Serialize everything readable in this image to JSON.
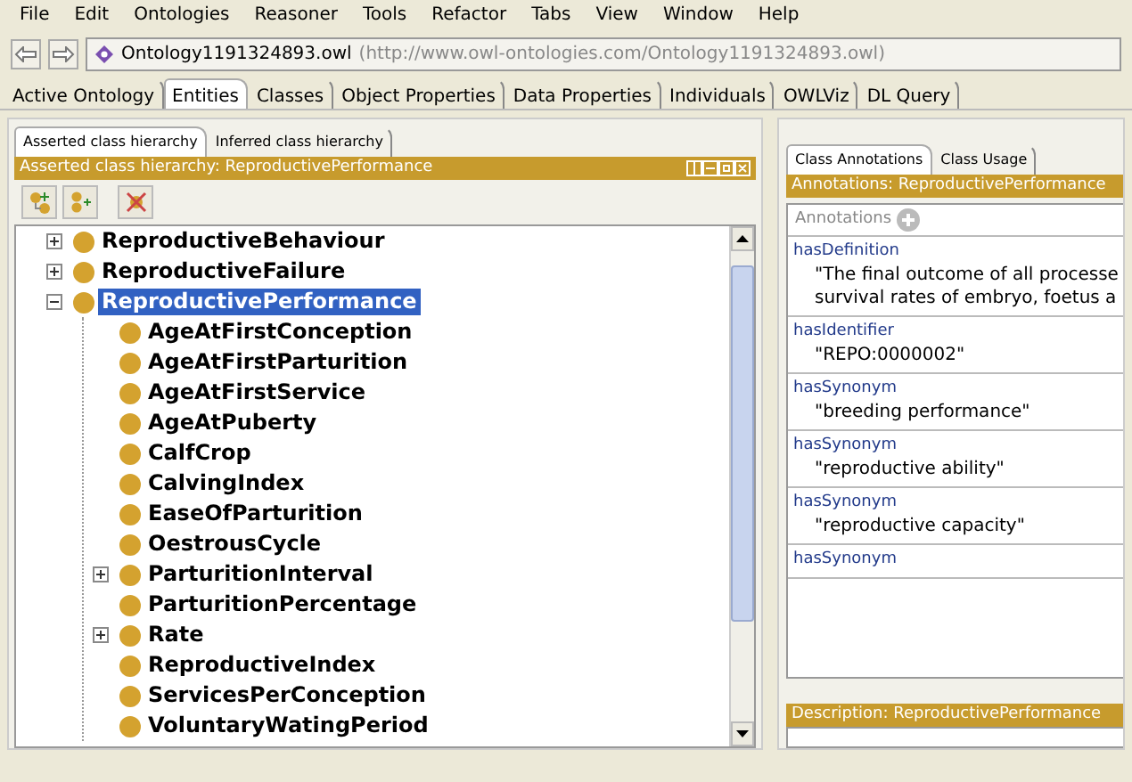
{
  "menu": [
    "File",
    "Edit",
    "Ontologies",
    "Reasoner",
    "Tools",
    "Refactor",
    "Tabs",
    "View",
    "Window",
    "Help"
  ],
  "address": {
    "name": "Ontology1191324893.owl",
    "uri": "(http://www.owl-ontologies.com/Ontology1191324893.owl)"
  },
  "tabs": [
    {
      "label": "Active Ontology",
      "selected": false
    },
    {
      "label": "Entities",
      "selected": true
    },
    {
      "label": "Classes",
      "selected": false
    },
    {
      "label": "Object Properties",
      "selected": false
    },
    {
      "label": "Data Properties",
      "selected": false
    },
    {
      "label": "Individuals",
      "selected": false
    },
    {
      "label": "OWLViz",
      "selected": false
    },
    {
      "label": "DL Query",
      "selected": false
    }
  ],
  "hierarchy": {
    "tabs": [
      {
        "label": "Asserted class hierarchy",
        "selected": true
      },
      {
        "label": "Inferred class hierarchy",
        "selected": false
      }
    ],
    "title": "Asserted class hierarchy: ReproductivePerformance",
    "tree": [
      {
        "label": "ReproductiveBehaviour",
        "expanded": false,
        "selected": false
      },
      {
        "label": "ReproductiveFailure",
        "expanded": false,
        "selected": false
      },
      {
        "label": "ReproductivePerformance",
        "expanded": true,
        "selected": true,
        "children": [
          {
            "label": "AgeAtFirstConception",
            "selected": false
          },
          {
            "label": "AgeAtFirstParturition",
            "selected": false
          },
          {
            "label": "AgeAtFirstService",
            "selected": false
          },
          {
            "label": "AgeAtPuberty",
            "selected": false
          },
          {
            "label": "CalfCrop",
            "selected": false
          },
          {
            "label": "CalvingIndex",
            "selected": false
          },
          {
            "label": "EaseOfParturition",
            "selected": false
          },
          {
            "label": "OestrousCycle",
            "selected": false
          },
          {
            "label": "ParturitionInterval",
            "expanded": false,
            "selected": false
          },
          {
            "label": "ParturitionPercentage",
            "selected": false
          },
          {
            "label": "Rate",
            "expanded": false,
            "selected": false
          },
          {
            "label": "ReproductiveIndex",
            "selected": false
          },
          {
            "label": "ServicesPerConception",
            "selected": false
          },
          {
            "label": "VoluntaryWatingPeriod",
            "selected": false
          }
        ]
      }
    ]
  },
  "annotations_panel": {
    "tabs": [
      {
        "label": "Class Annotations",
        "selected": true
      },
      {
        "label": "Class Usage",
        "selected": false
      }
    ],
    "title": "Annotations: ReproductivePerformance",
    "header": "Annotations",
    "annotations": [
      {
        "property": "hasDefinition",
        "value": [
          "\"The final outcome of all processe",
          "survival rates of embryo, foetus a"
        ]
      },
      {
        "property": "hasIdentifier",
        "value": [
          "\"REPO:0000002\""
        ]
      },
      {
        "property": "hasSynonym",
        "value": [
          "\"breeding performance\""
        ]
      },
      {
        "property": "hasSynonym",
        "value": [
          "\"reproductive ability\""
        ]
      },
      {
        "property": "hasSynonym",
        "value": [
          "\"reproductive capacity\""
        ]
      },
      {
        "property": "hasSynonym"
      }
    ]
  },
  "description_panel": {
    "title": "Description: ReproductivePerformance"
  }
}
